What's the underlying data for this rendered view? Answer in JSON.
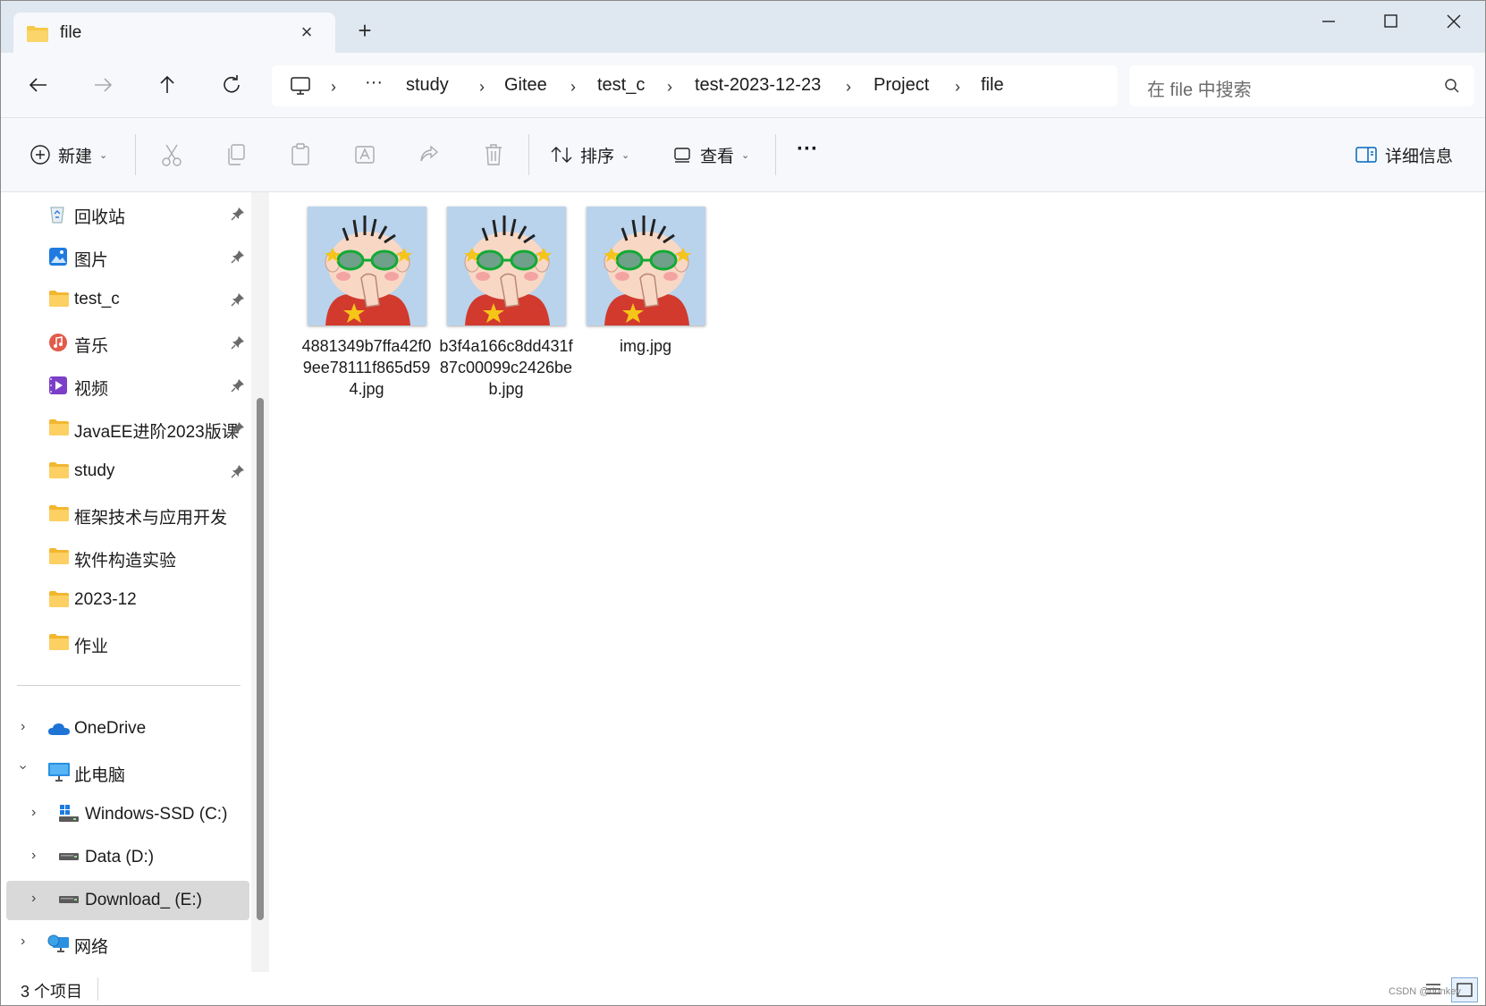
{
  "tab": {
    "title": "file",
    "close": "×",
    "new_tab": "+"
  },
  "address": {
    "crumbs": [
      "study",
      "Gitee",
      "test_c",
      "test-2023-12-23",
      "Project",
      "file"
    ],
    "more": "···",
    "separator": "›"
  },
  "search": {
    "placeholder": "在 file 中搜索"
  },
  "commands": {
    "new_label": "新建",
    "sort_label": "排序",
    "view_label": "查看",
    "more_label": "···",
    "details_label": "详细信息"
  },
  "sidebar": {
    "quick": [
      {
        "label": "回收站",
        "icon": "recycle-bin-icon"
      },
      {
        "label": "图片",
        "icon": "pictures-icon"
      },
      {
        "label": "test_c",
        "icon": "folder-icon"
      },
      {
        "label": "音乐",
        "icon": "music-icon"
      },
      {
        "label": "视频",
        "icon": "video-icon"
      },
      {
        "label": "JavaEE进阶2023版课",
        "icon": "folder-icon"
      },
      {
        "label": "study",
        "icon": "folder-icon"
      },
      {
        "label": "框架技术与应用开发",
        "icon": "folder-icon"
      },
      {
        "label": "软件构造实验",
        "icon": "folder-icon"
      },
      {
        "label": "2023-12",
        "icon": "folder-icon"
      },
      {
        "label": "作业",
        "icon": "folder-icon"
      }
    ],
    "tree": [
      {
        "label": "OneDrive",
        "icon": "onedrive-icon"
      },
      {
        "label": "此电脑",
        "icon": "this-pc-icon"
      },
      {
        "label": "Windows-SSD (C:)",
        "icon": "windows-drive-icon"
      },
      {
        "label": "Data (D:)",
        "icon": "drive-icon"
      },
      {
        "label": "Download_ (E:)",
        "icon": "drive-icon",
        "selected": true
      },
      {
        "label": "网络",
        "icon": "network-icon"
      }
    ]
  },
  "files": [
    {
      "name": "4881349b7ffa42f09ee78111f865d594.jpg"
    },
    {
      "name": "b3f4a166c8dd431f87c00099c2426beb.jpg"
    },
    {
      "name": "img.jpg"
    }
  ],
  "status": {
    "count": "3 个项目",
    "watermark": "CSDN @donkey"
  },
  "colors": {
    "folder": "#f7c948",
    "accent": "#0067c0",
    "thumb_bg": "#b9d3ec"
  }
}
